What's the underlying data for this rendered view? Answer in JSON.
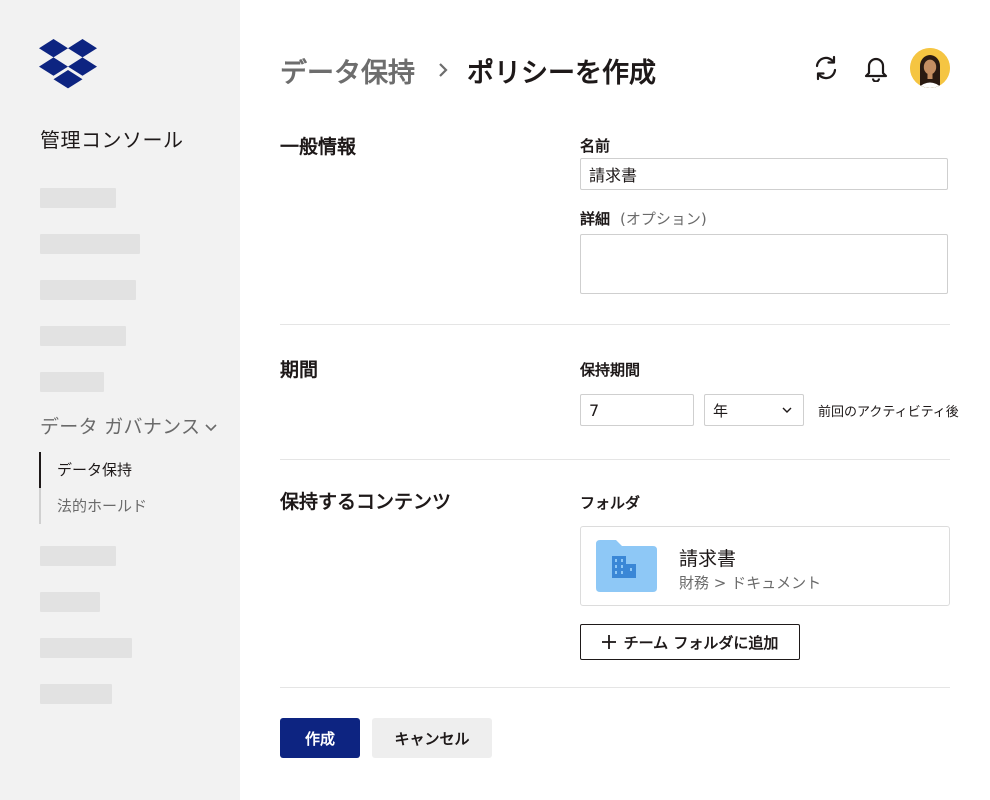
{
  "sidebar": {
    "logo_icon": "dropbox-logo",
    "console_title": "管理コンソール",
    "governance_heading": "データ ガバナンス",
    "subnav": [
      {
        "label": "データ保持",
        "active": true
      },
      {
        "label": "法的ホールド",
        "active": false
      }
    ]
  },
  "header": {
    "breadcrumb_parent": "データ保持",
    "breadcrumb_current": "ポリシーを作成",
    "icons": [
      "sync-icon",
      "bell-icon",
      "avatar"
    ]
  },
  "general": {
    "section_title": "一般情報",
    "name_label": "名前",
    "name_value": "請求書",
    "detail_label": "詳細",
    "detail_optional": "(オプション)",
    "detail_value": ""
  },
  "period": {
    "section_title": "期間",
    "retention_label": "保持期間",
    "retention_value": "7",
    "unit_selected": "年",
    "after_text": "前回のアクティビティ後"
  },
  "contents": {
    "section_title": "保持するコンテンツ",
    "folder_label": "フォルダ",
    "folder": {
      "name": "請求書",
      "path": "財務 > ドキュメント"
    },
    "add_button": "チーム フォルダに追加"
  },
  "actions": {
    "create_label": "作成",
    "cancel_label": "キャンセル"
  },
  "colors": {
    "primary": "#0d2481",
    "logo": "#0d2481",
    "folder": "#8ec8f6",
    "sidebar_bg": "#f2f2f2",
    "avatar_bg": "#f5c542"
  }
}
